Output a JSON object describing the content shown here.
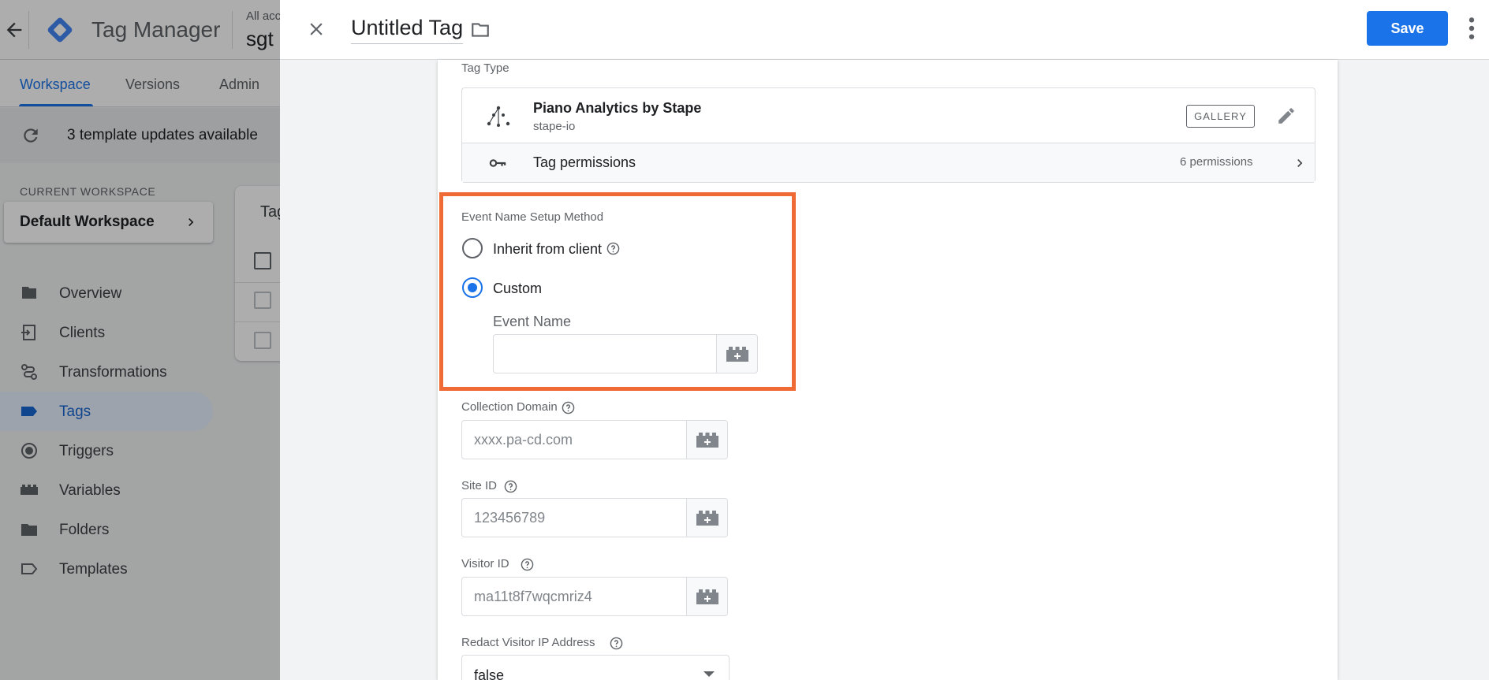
{
  "app": {
    "title": "Tag Manager",
    "account_small": "All acc",
    "account_big": "sgt",
    "nav_tabs": [
      "Workspace",
      "Versions",
      "Admin"
    ],
    "updates_text": "3 template updates available",
    "current_workspace_label": "CURRENT WORKSPACE",
    "current_workspace_name": "Default Workspace",
    "sidebar": [
      {
        "label": "Overview",
        "icon": "overview-icon"
      },
      {
        "label": "Clients",
        "icon": "clients-icon"
      },
      {
        "label": "Transformations",
        "icon": "transformations-icon"
      },
      {
        "label": "Tags",
        "icon": "tags-icon"
      },
      {
        "label": "Triggers",
        "icon": "triggers-icon"
      },
      {
        "label": "Variables",
        "icon": "variables-icon"
      },
      {
        "label": "Folders",
        "icon": "folders-icon"
      },
      {
        "label": "Templates",
        "icon": "templates-icon"
      }
    ],
    "card_title": "Tag"
  },
  "editor": {
    "tag_name": "Untitled Tag",
    "save_label": "Save",
    "tag_type_label": "Tag Type",
    "tag_type_name": "Piano Analytics by Stape",
    "tag_type_vendor": "stape-io",
    "gallery_badge": "GALLERY",
    "permissions_label": "Tag permissions",
    "permissions_count": "6 permissions",
    "event_method_label": "Event Name Setup Method",
    "radio_inherit": "Inherit from client",
    "radio_custom": "Custom",
    "event_name_label": "Event Name",
    "event_name_value": "",
    "collection_domain_label": "Collection Domain",
    "collection_domain_placeholder": "xxxx.pa-cd.com",
    "site_id_label": "Site ID",
    "site_id_placeholder": "123456789",
    "visitor_id_label": "Visitor ID",
    "visitor_id_placeholder": "ma11t8f7wqcmriz4",
    "redact_label": "Redact Visitor IP Address",
    "redact_value": "false"
  },
  "colors": {
    "accent": "#1a73e8",
    "highlight": "#f06a35"
  }
}
